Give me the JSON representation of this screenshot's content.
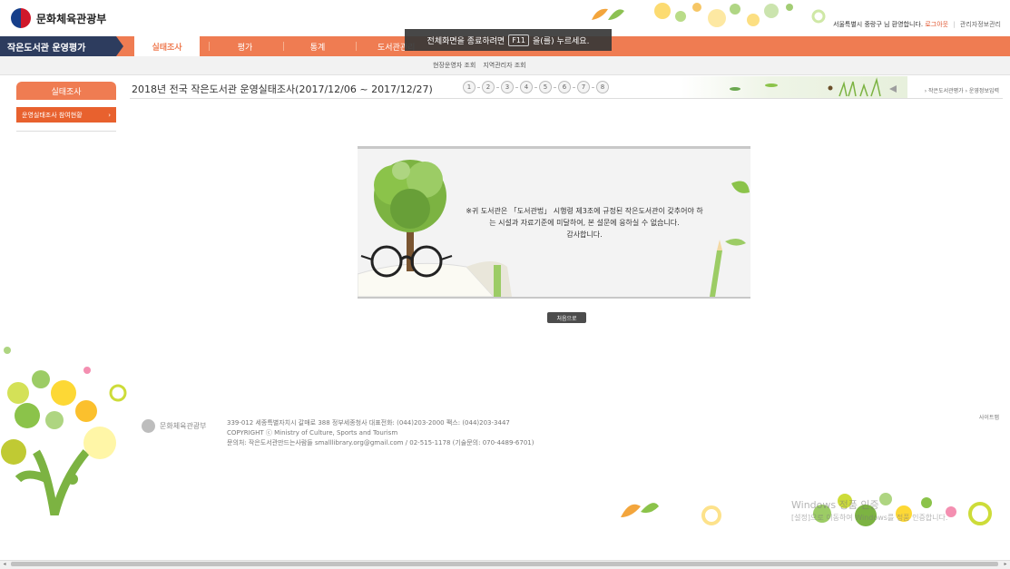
{
  "header": {
    "logo_text": "문화체육관광부",
    "user_greeting": "서울특별시 중랑구 님 환영합니다.",
    "logout": "로그아웃",
    "separator": "|",
    "admin_info": "관리자정보관리"
  },
  "nav": {
    "brand": "작은도서관 운영평가",
    "tabs": [
      {
        "label": "실태조사",
        "active": true
      },
      {
        "label": "평가"
      },
      {
        "label": "통계"
      },
      {
        "label": "도서관관리"
      }
    ]
  },
  "fullscreen_toast": {
    "prefix": "전체화면을 종료하려면",
    "key": "F11",
    "suffix": "을(를) 누르세요."
  },
  "subnav": {
    "links": [
      "현장운영자 조회",
      "지역관리자 조회"
    ]
  },
  "sidebar": {
    "title": "실태조사",
    "items": [
      {
        "label": "운영실태조사 참여현황",
        "arrow": "›"
      }
    ]
  },
  "main": {
    "title": "2018년 전국 작은도서관 운영실태조사(2017/12/06 ~ 2017/12/27)",
    "steps": [
      "1",
      "2",
      "3",
      "4",
      "5",
      "6",
      "7",
      "8"
    ],
    "breadcrumb": "› 작은도서관평가 › 운영정보입력",
    "notice_lines": [
      "※귀 도서관은 「도서관법」 시행령 제3조에 규정된 작은도서관이 갖추어야 하",
      "는 시설과 자료기준에 미달하여, 본 설문에 응하실 수 없습니다.",
      "감사합니다."
    ],
    "home_button": "처음으로"
  },
  "footer": {
    "logo_text": "문화체육관광부",
    "address": "339-012 세종특별자치시 갈매로 388 정부세종청사 대표전화: (044)203-2000 팩스: (044)203-3447",
    "copyright": "COPYRIGHT ⓒ Ministry of Culture, Sports and Tourism",
    "contact": "문의처: 작은도서관만드는사람들 smalllibrary.org@gmail.com / 02-515-1178 (기술문의: 070-4489-6701)",
    "sitemap": "사이트맵",
    "watermark_title": "Windows 정품 인증",
    "watermark_sub": "[설정]으로 이동하여 Windows를 정품 인증합니다."
  },
  "colors": {
    "accent": "#ef7c52",
    "nav_brand": "#2d3c5e",
    "sidebar_item": "#e8612e"
  }
}
